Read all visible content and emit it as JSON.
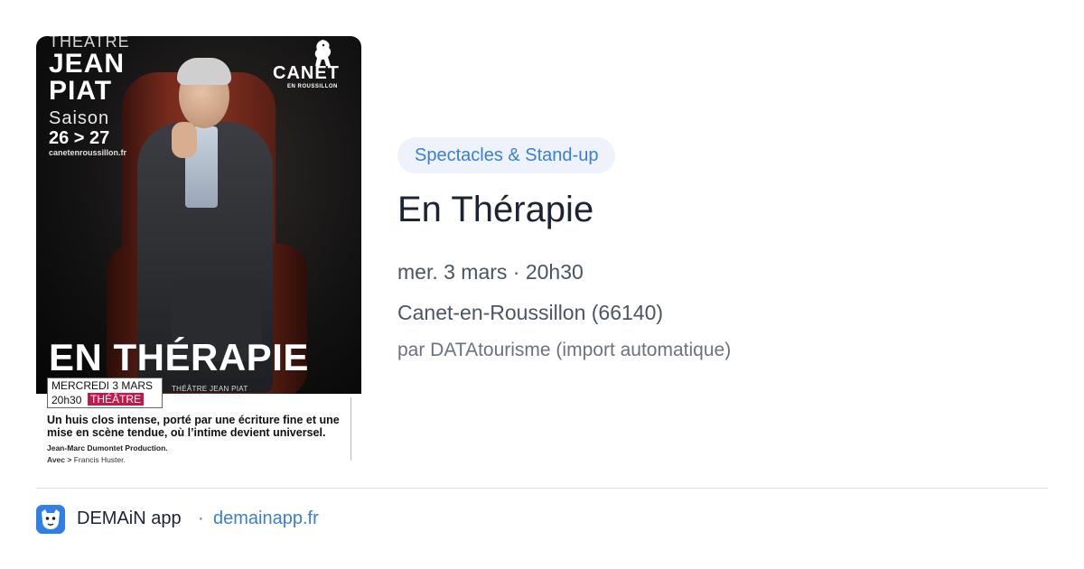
{
  "poster": {
    "theatre_label": "THEATRE",
    "venue_line1": "JEAN",
    "venue_line2": "PIAT",
    "season_label": "Saison",
    "season_years": "26 > 27",
    "website": "canetenroussillon.fr",
    "city_logo_text": "CANET",
    "city_logo_subtext": "EN ROUSSILLON",
    "show_title": "EN THÉRAPIE",
    "date_text": "MERCREDI 3 MARS",
    "time_text": "20h30",
    "category_text": "THÉÂTRE",
    "venue_text": "THÉÂTRE JEAN PIAT",
    "description": "Un huis clos intense, porté par une écriture fine et une mise en scène tendue, où l’intime devient universel.",
    "production": "Jean-Marc Dumontet Production.",
    "cast_label": "Avec >",
    "cast_names": "Francis Huster."
  },
  "event": {
    "category": "Spectacles & Stand-up",
    "title": "En Thérapie",
    "datetime": "mer. 3 mars · 20h30",
    "location": "Canet-en-Roussillon (66140)",
    "source": "par DATAtourisme (import automatique)"
  },
  "footer": {
    "app_name": "DEMAiN app",
    "separator": "·",
    "url": "demainapp.fr"
  },
  "colors": {
    "accent": "#3b7ed6",
    "tag_bg": "#eef3fb",
    "title_text": "#1b2434",
    "poster_category_badge": "#c2184b"
  }
}
